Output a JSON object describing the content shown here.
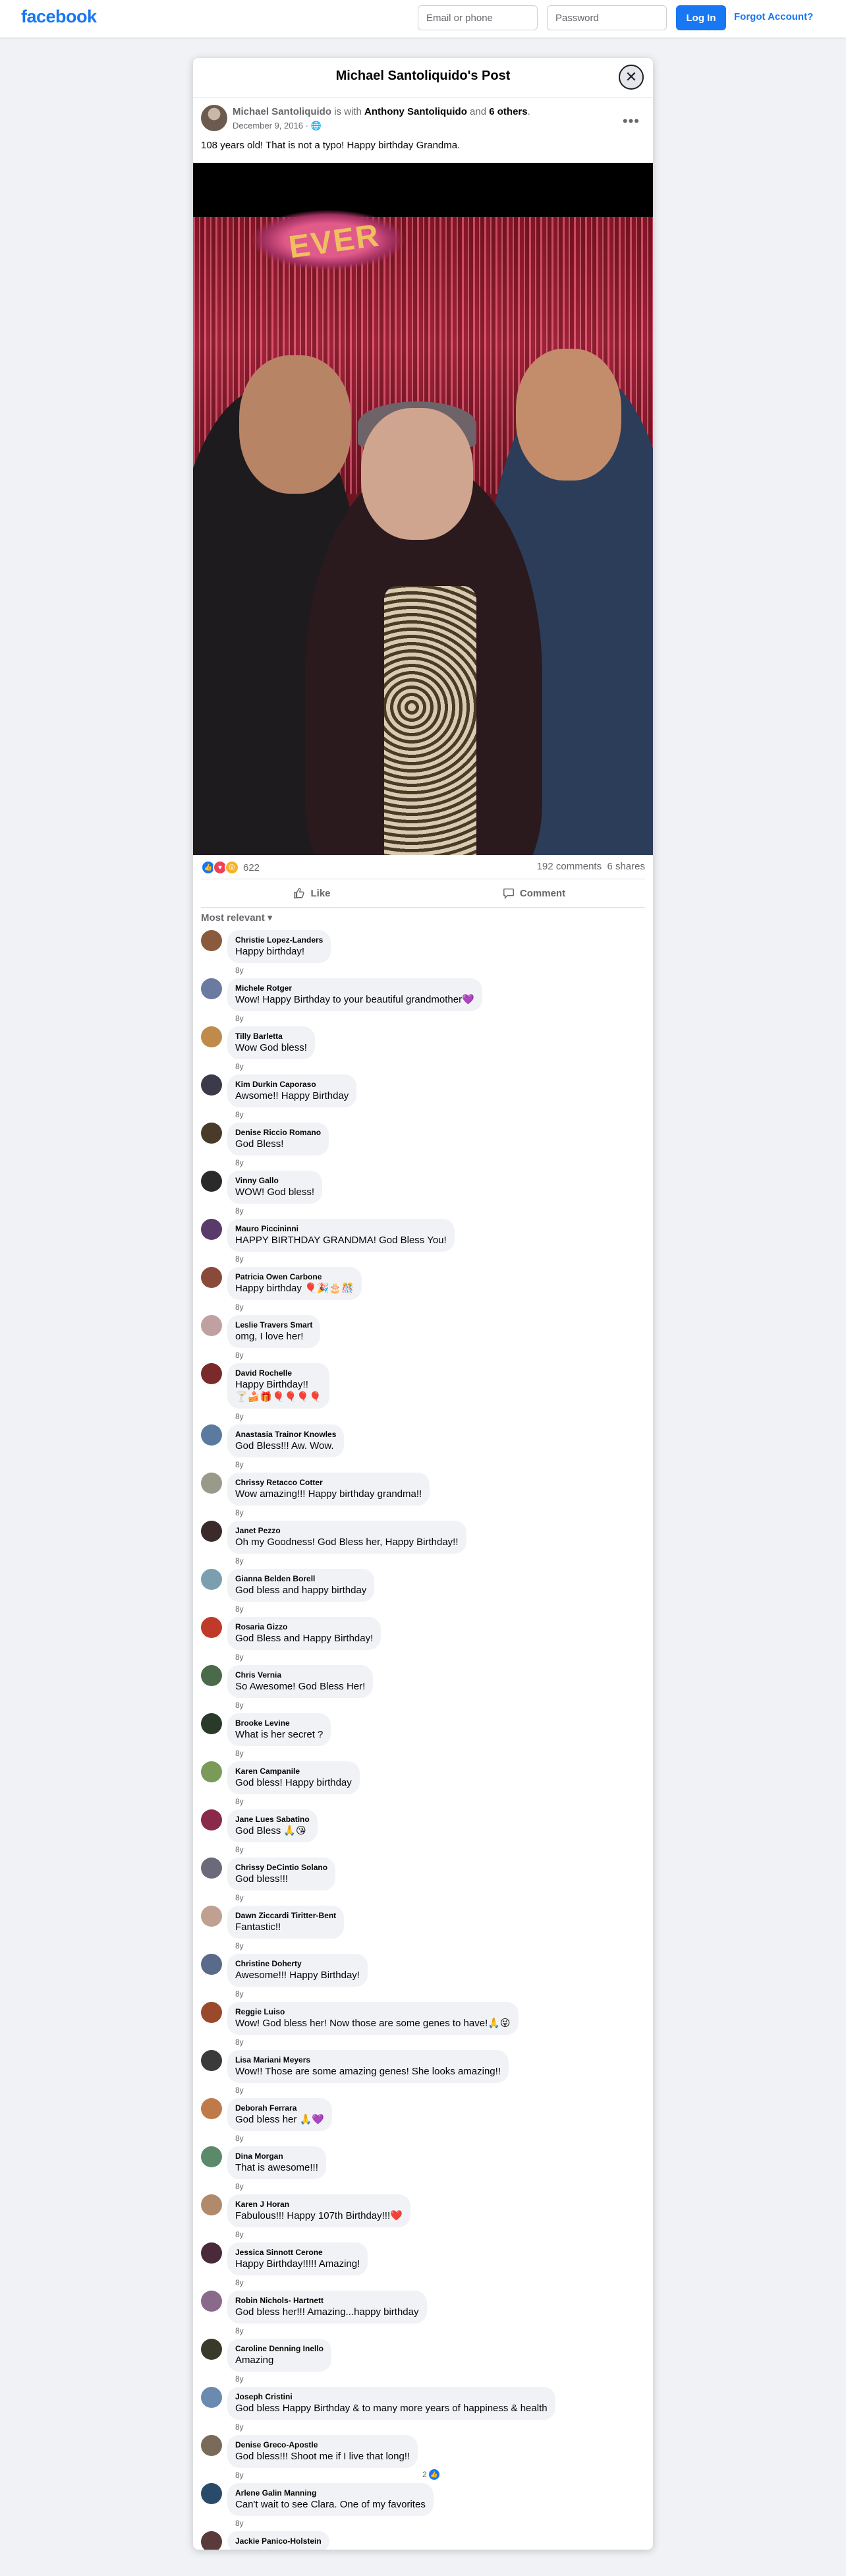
{
  "topbar": {
    "logo": "facebook",
    "email_placeholder": "Email or phone",
    "password_placeholder": "Password",
    "login_label": "Log In",
    "forgot_label": "Forgot Account?"
  },
  "modal": {
    "title": "Michael Santoliquido's Post",
    "close_glyph": "✕"
  },
  "post": {
    "author": "Michael Santoliquido",
    "is_with": "is with",
    "tagged": "Anthony Santoliquido",
    "and": "and",
    "others": "6 others",
    "period": ".",
    "date": "December 9, 2016",
    "privacy_icon": "globe-icon",
    "text": "108 years old! That is not a typo!  Happy birthday Grandma.",
    "photo_sign": "EVER"
  },
  "stats": {
    "reaction_count": "622",
    "comments": "192 comments",
    "shares": "6 shares"
  },
  "actions": {
    "like": "Like",
    "comment": "Comment"
  },
  "sort_label": "Most relevant",
  "comments": [
    {
      "name": "Christie Lopez-Landers",
      "text": "Happy birthday!",
      "time": "8y",
      "avatar": "#8a5a3c"
    },
    {
      "name": "Michele Rotger",
      "text": "Wow! Happy Birthday to your beautiful grandmother💜",
      "time": "8y",
      "avatar": "#6a7aa0"
    },
    {
      "name": "Tilly Barletta",
      "text": "Wow God bless!",
      "time": "8y",
      "avatar": "#c08a4a"
    },
    {
      "name": "Kim Durkin Caporaso",
      "text": "Awsome!! Happy Birthday",
      "time": "8y",
      "avatar": "#3a3a4a"
    },
    {
      "name": "Denise Riccio Romano",
      "text": "God Bless!",
      "time": "8y",
      "avatar": "#4a3a2a"
    },
    {
      "name": "Vinny Gallo",
      "text": "WOW! God bless!",
      "time": "8y",
      "avatar": "#2a2a2a"
    },
    {
      "name": "Mauro Piccininni",
      "text": "HAPPY BIRTHDAY GRANDMA! God Bless You!",
      "time": "8y",
      "avatar": "#5a3a6a"
    },
    {
      "name": "Patricia Owen Carbone",
      "text": "Happy birthday 🎈🎉🎂🎊",
      "time": "8y",
      "avatar": "#8a4a3a"
    },
    {
      "name": "Leslie Travers Smart",
      "text": "omg, I love her!",
      "time": "8y",
      "avatar": "#c0a0a0"
    },
    {
      "name": "David Rochelle",
      "text": "Happy Birthday!!",
      "text2": "🍸🍰🎁🎈🎈🎈🎈",
      "time": "8y",
      "avatar": "#7a2a2a"
    },
    {
      "name": "Anastasia Trainor Knowles",
      "text": "God Bless!!! Aw. Wow.",
      "time": "8y",
      "avatar": "#5a7aa0"
    },
    {
      "name": "Chrissy Retacco Cotter",
      "text": "Wow amazing!!! Happy birthday grandma!!",
      "time": "8y",
      "avatar": "#9a9a8a"
    },
    {
      "name": "Janet Pezzo",
      "text": "Oh my Goodness! God Bless her, Happy Birthday!!",
      "time": "8y",
      "avatar": "#3a2a2a"
    },
    {
      "name": "Gianna Belden Borell",
      "text": "God bless and happy birthday",
      "time": "8y",
      "avatar": "#7aa0b0"
    },
    {
      "name": "Rosaria Gizzo",
      "text": "God Bless and Happy Birthday!",
      "time": "8y",
      "avatar": "#c03a2a"
    },
    {
      "name": "Chris Vernia",
      "text": "So Awesome! God Bless Her!",
      "time": "8y",
      "avatar": "#4a6a4a"
    },
    {
      "name": "Brooke Levine",
      "text": "What is her secret ?",
      "time": "8y",
      "avatar": "#2a3a2a"
    },
    {
      "name": "Karen Campanile",
      "text": "God bless! Happy birthday",
      "time": "8y",
      "avatar": "#7a9a5a"
    },
    {
      "name": "Jane Lues Sabatino",
      "text": "God Bless 🙏😘",
      "time": "8y",
      "avatar": "#8a2a4a"
    },
    {
      "name": "Chrissy DeCintio Solano",
      "text": "God bless!!!",
      "time": "8y",
      "avatar": "#6a6a7a"
    },
    {
      "name": "Dawn Ziccardi Tiritter-Bent",
      "text": "Fantastic!!",
      "time": "8y",
      "avatar": "#c0a090"
    },
    {
      "name": "Christine Doherty",
      "text": "Awesome!!! Happy Birthday!",
      "time": "8y",
      "avatar": "#5a6a8a"
    },
    {
      "name": "Reggie Luiso",
      "text": "Wow! God bless her! Now those are some genes to have!🙏😜",
      "time": "8y",
      "avatar": "#9a4a2a"
    },
    {
      "name": "Lisa Mariani Meyers",
      "text": "Wow!! Those are some amazing genes! She looks amazing!!",
      "time": "8y",
      "avatar": "#3a3a3a"
    },
    {
      "name": "Deborah Ferrara",
      "text": "God bless her 🙏💜",
      "time": "8y",
      "avatar": "#c07a4a"
    },
    {
      "name": "Dina Morgan",
      "text": "That is awesome!!!",
      "time": "8y",
      "avatar": "#5a8a6a"
    },
    {
      "name": "Karen J Horan",
      "text": "Fabulous!!! Happy 107th Birthday!!!❤️",
      "time": "8y",
      "avatar": "#b08a6a"
    },
    {
      "name": "Jessica Sinnott Cerone",
      "text": "Happy Birthday!!!!! Amazing!",
      "time": "8y",
      "avatar": "#4a2a3a"
    },
    {
      "name": "Robin Nichols- Hartnett",
      "text": "God bless her!!! Amazing...happy birthday",
      "time": "8y",
      "avatar": "#8a6a8a"
    },
    {
      "name": "Caroline Denning Inello",
      "text": "Amazing",
      "time": "8y",
      "avatar": "#3a3a2a"
    },
    {
      "name": "Joseph Cristini",
      "text": "God bless Happy Birthday & to many more years of happiness & health",
      "time": "8y",
      "avatar": "#6a8ab0"
    },
    {
      "name": "Denise Greco-Apostle",
      "text": "God bless!!! Shoot me if I live that long!!",
      "time": "8y",
      "avatar": "#7a6a5a",
      "likes": "2"
    },
    {
      "name": "Arlene Galin Manning",
      "text": "Can't wait to see Clara. One of my favorites",
      "time": "8y",
      "avatar": "#2a4a6a"
    },
    {
      "name": "Jackie Panico-Holstein",
      "text": "",
      "time": "",
      "avatar": "#5a3a3a"
    }
  ]
}
